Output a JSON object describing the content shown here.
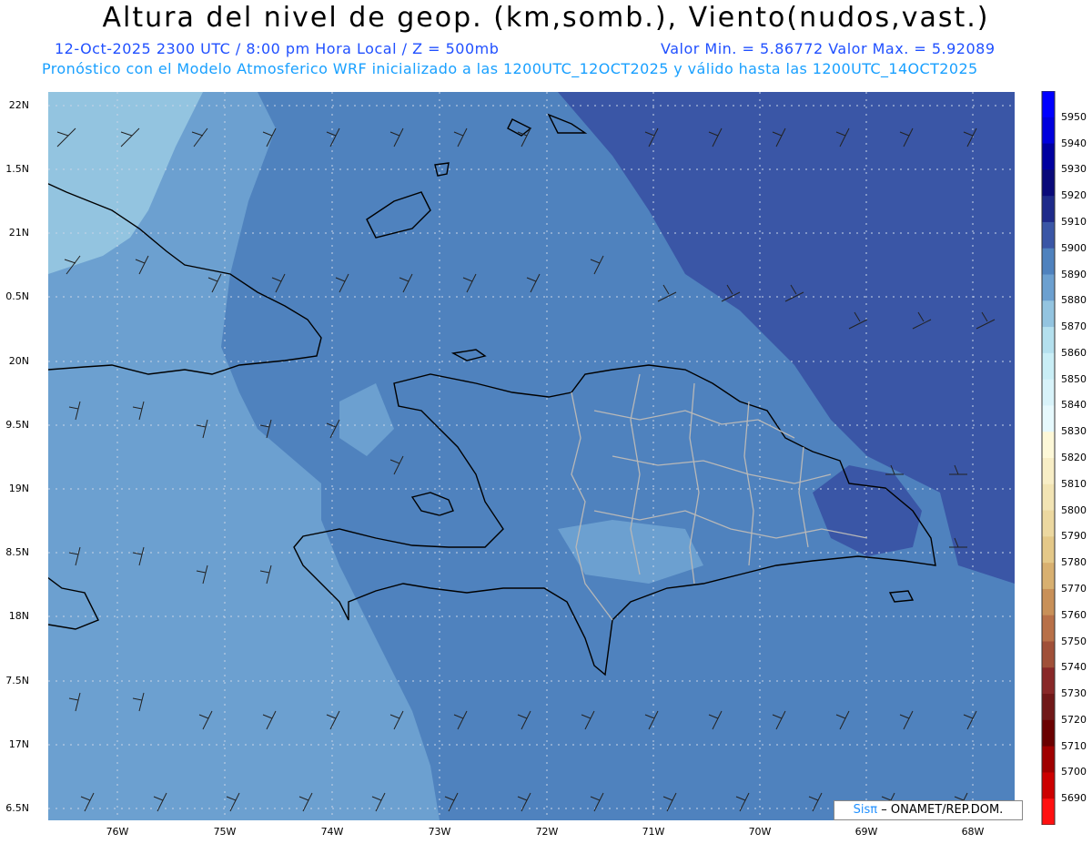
{
  "title": "Altura del nivel de geop. (km,somb.), Viento(nudos,vast.)",
  "subtitle_left": "12-Oct-2025  2300 UTC / 8:00 pm Hora Local / Z = 500mb",
  "subtitle_right": "Valor Min. = 5.86772  Valor Max. = 5.92089",
  "subtitle2": "Pronóstico con el Modelo Atmosferico WRF inicializado a las 1200UTC_12OCT2025 y válido hasta las  1200UTC_14OCT2025",
  "credit": {
    "brand": "Sisπ",
    "rest": "– ONAMET/REP.DOM."
  },
  "lat_labels": [
    "22N",
    "1.5N",
    "21N",
    "0.5N",
    "20N",
    "9.5N",
    "19N",
    "8.5N",
    "18N",
    "7.5N",
    "17N",
    "6.5N"
  ],
  "lon_labels": [
    "76W",
    "75W",
    "74W",
    "73W",
    "72W",
    "71W",
    "70W",
    "69W",
    "68W"
  ],
  "colorbar": {
    "levels": [
      5950,
      5940,
      5930,
      5920,
      5910,
      5900,
      5890,
      5880,
      5870,
      5860,
      5850,
      5840,
      5830,
      5820,
      5810,
      5800,
      5790,
      5780,
      5770,
      5760,
      5750,
      5740,
      5730,
      5720,
      5710,
      5700,
      5690
    ],
    "colors": [
      "#0000ff",
      "#0000dd",
      "#0000a0",
      "#0a0a7a",
      "#1e2a8a",
      "#3a56a6",
      "#4f82be",
      "#6ca0d0",
      "#93c4e0",
      "#b4e0ee",
      "#c9eef6",
      "#d8f3fa",
      "#e6f9fd",
      "#fdf8d8",
      "#f8eec6",
      "#f2e4b4",
      "#ecd8a0",
      "#e4c888",
      "#d8b070",
      "#c89058",
      "#b87048",
      "#a05038",
      "#882828",
      "#701818",
      "#6a0000",
      "#a00000",
      "#cc0000",
      "#ff1010"
    ]
  },
  "field_colors": {
    "c5870": "#93c4e0",
    "c5880": "#6ca0d0",
    "c5890": "#4f82be",
    "c5900": "#3a56a6"
  }
}
